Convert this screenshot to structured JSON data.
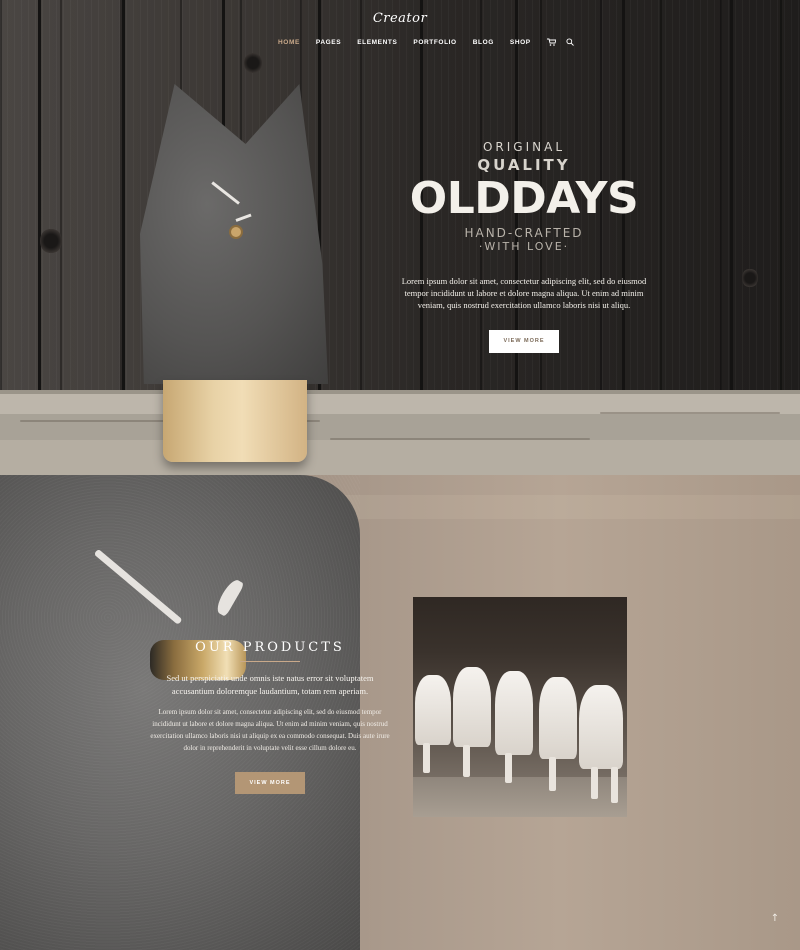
{
  "brand": {
    "logo": "Creator"
  },
  "nav": {
    "items": [
      {
        "label": "HOME",
        "active": true
      },
      {
        "label": "PAGES",
        "active": false
      },
      {
        "label": "ELEMENTS",
        "active": false
      },
      {
        "label": "PORTFOLIO",
        "active": false
      },
      {
        "label": "BLOG",
        "active": false
      },
      {
        "label": "SHOP",
        "active": false
      }
    ],
    "icons": [
      "cart-icon",
      "search-icon"
    ],
    "accent_color": "#c9a98a"
  },
  "hero": {
    "line1": "ORIGINAL",
    "line2": "QUALITY",
    "brand_word": "OLDDAYS",
    "line3": "HAND-CRAFTED",
    "line4": "·WITH LOVE·",
    "body": "Lorem ipsum dolor sit amet, consectetur adipiscing elit, sed do eiusmod tempor incididunt ut labore et dolore magna aliqua. Ut enim ad minim veniam, quis nostrud exercitation ullamco laboris nisi ut aliqu.",
    "button": "VIEW MORE"
  },
  "products": {
    "title": "OUR PRODUCTS",
    "lead": "Sed ut perspiciatis unde omnis iste natus error sit voluptatem accusantium doloremque laudantium, totam rem aperiam.",
    "body": "Lorem ipsum dolor sit amet, consectetur adipiscing elit, sed do eiusmod tempor incididunt ut labore et dolore magna aliqua. Ut enim ad minim veniam, quis nostrud exercitation ullamco laboris nisi ut aliquip ex ea commodo consequat. Duis aute irure dolor in reprehenderit in voluptate velit esse cillum dolore eu.",
    "button": "VIEW MORE",
    "button_color": "#b39675"
  },
  "scroll_top": "↑"
}
